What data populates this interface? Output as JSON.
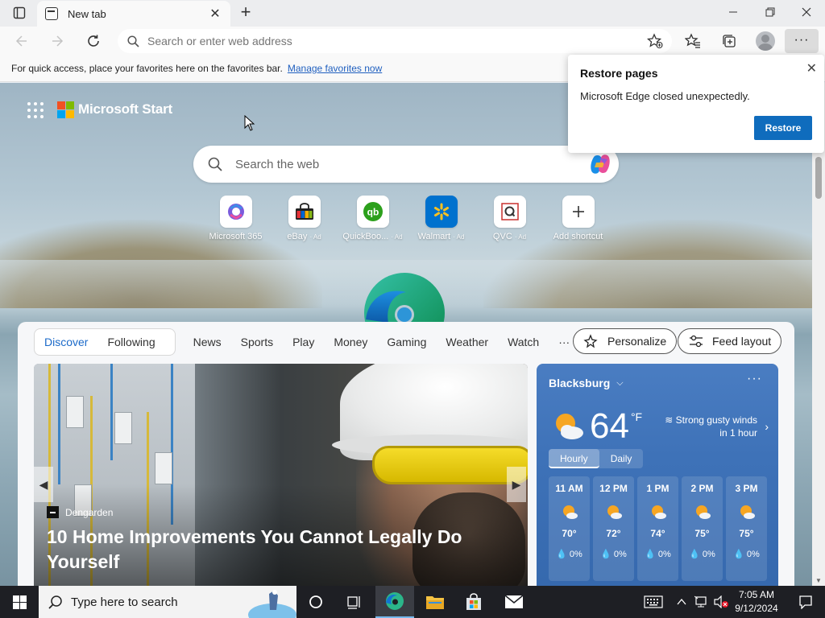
{
  "tab": {
    "title": "New tab"
  },
  "address": {
    "placeholder": "Search or enter web address"
  },
  "favorites_bar": {
    "message": "For quick access, place your favorites here on the favorites bar.",
    "link": "Manage favorites now"
  },
  "start_page": {
    "brand": "Microsoft Start",
    "search_placeholder": "Search the web",
    "shortcuts": [
      {
        "label": "Microsoft 365",
        "ad": "",
        "icon": "microsoft-365-icon"
      },
      {
        "label": "eBay",
        "ad": "· Ad",
        "icon": "ebay-icon"
      },
      {
        "label": "QuickBoo...",
        "ad": "· Ad",
        "icon": "quickbooks-icon"
      },
      {
        "label": "Walmart",
        "ad": "· Ad",
        "icon": "walmart-icon"
      },
      {
        "label": "QVC",
        "ad": "· Ad",
        "icon": "qvc-icon"
      },
      {
        "label": "Add shortcut",
        "ad": "",
        "icon": "plus-icon"
      }
    ]
  },
  "feed": {
    "tabs": [
      "Discover",
      "Following",
      "News",
      "Sports",
      "Play",
      "Money",
      "Gaming",
      "Weather",
      "Watch",
      "···"
    ],
    "personalize": "Personalize",
    "layout": "Feed layout",
    "hero": {
      "source": "Dengarden",
      "headline": "10 Home Improvements You Cannot Legally Do Yourself"
    }
  },
  "weather": {
    "city": "Blacksburg",
    "temp": "64",
    "unit": "°F",
    "alert_line1": "Strong gusty winds",
    "alert_line2": "in 1 hour",
    "toggle": [
      "Hourly",
      "Daily"
    ],
    "hours": [
      {
        "time": "11 AM",
        "temp": "70°",
        "precip": "0%"
      },
      {
        "time": "12 PM",
        "temp": "72°",
        "precip": "0%"
      },
      {
        "time": "1 PM",
        "temp": "74°",
        "precip": "0%"
      },
      {
        "time": "2 PM",
        "temp": "75°",
        "precip": "0%"
      },
      {
        "time": "3 PM",
        "temp": "75°",
        "precip": "0%"
      }
    ]
  },
  "popup": {
    "title": "Restore pages",
    "message": "Microsoft Edge closed unexpectedly.",
    "button": "Restore"
  },
  "taskbar": {
    "search_placeholder": "Type here to search",
    "time": "7:05 AM",
    "date": "9/12/2024"
  },
  "colors": {
    "accent": "#0f6cbd",
    "weather_bg": "#3e72b8",
    "taskbar": "#1e1f24"
  }
}
